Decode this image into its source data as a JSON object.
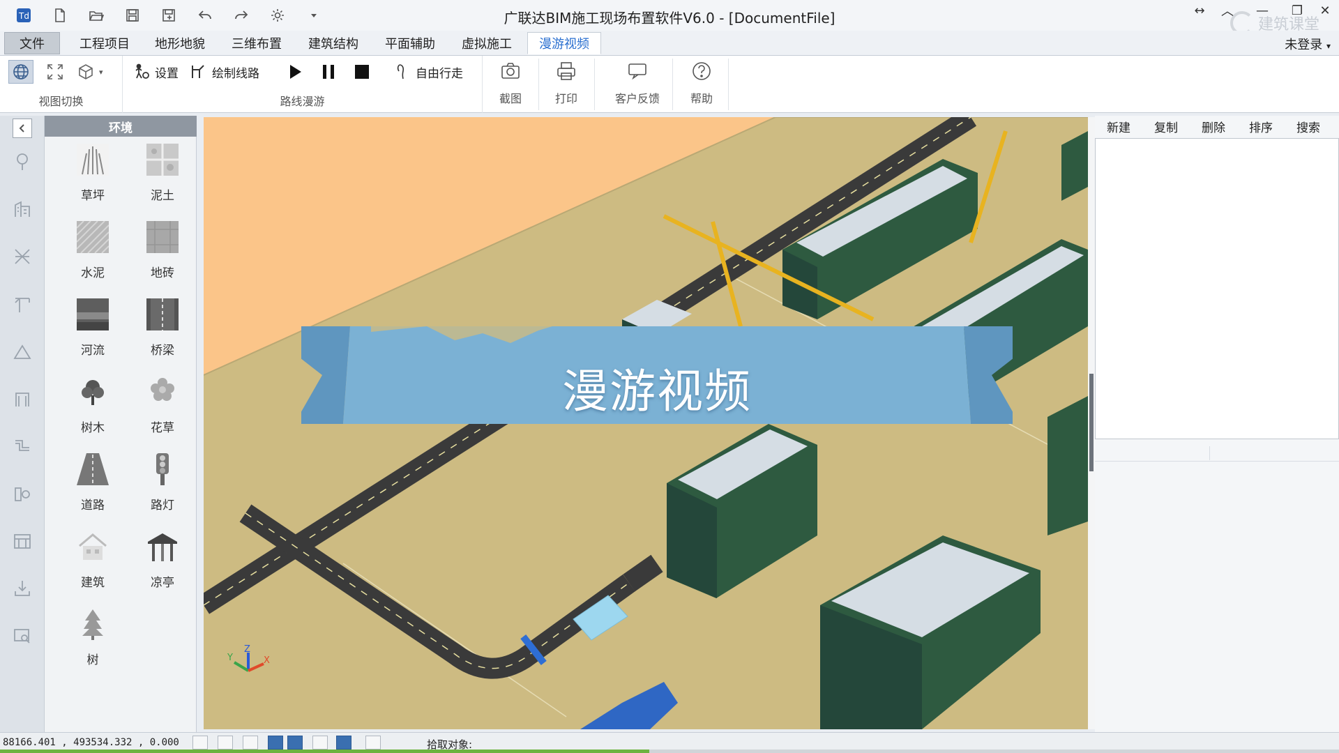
{
  "window": {
    "title": "广联达BIM施工现场布置软件V6.0 - [DocumentFile]",
    "user": "未登录",
    "brand_mark": "建筑课堂"
  },
  "quick_access": [
    "app-logo-icon",
    "new-file-icon",
    "open-folder-icon",
    "save-icon",
    "save-as-icon",
    "undo-icon",
    "redo-icon",
    "gear-icon",
    "dropdown-arrow-icon"
  ],
  "menu": {
    "tabs": [
      {
        "label": "文件",
        "id": "file"
      },
      {
        "label": "工程项目",
        "id": "project"
      },
      {
        "label": "地形地貌",
        "id": "terrain"
      },
      {
        "label": "三维布置",
        "id": "layout3d"
      },
      {
        "label": "建筑结构",
        "id": "structure"
      },
      {
        "label": "平面辅助",
        "id": "plane-aid"
      },
      {
        "label": "虚拟施工",
        "id": "virtual-build"
      },
      {
        "label": "漫游视频",
        "id": "walkthrough"
      }
    ],
    "active": "漫游视频"
  },
  "ribbon": {
    "view_switch": {
      "label": "视图切换"
    },
    "route_tour": {
      "label": "路线漫游",
      "settings": "设置",
      "draw_route": "绘制线路",
      "free_walk": "自由行走"
    },
    "screenshot": "截图",
    "print": "打印",
    "feedback": "客户反馈",
    "help": "帮助"
  },
  "palette": {
    "title": "环境",
    "items": [
      {
        "label": "草坪",
        "icon": "grass-icon"
      },
      {
        "label": "泥土",
        "icon": "soil-icon"
      },
      {
        "label": "水泥",
        "icon": "cement-icon"
      },
      {
        "label": "地砖",
        "icon": "floor-tile-icon"
      },
      {
        "label": "河流",
        "icon": "river-icon"
      },
      {
        "label": "桥梁",
        "icon": "bridge-icon"
      },
      {
        "label": "树木",
        "icon": "trees-icon"
      },
      {
        "label": "花草",
        "icon": "flower-icon"
      },
      {
        "label": "道路",
        "icon": "road-icon"
      },
      {
        "label": "路灯",
        "icon": "street-lamp-icon"
      },
      {
        "label": "建筑",
        "icon": "building-icon"
      },
      {
        "label": "凉亭",
        "icon": "pavilion-icon"
      },
      {
        "label": "树",
        "icon": "pine-tree-icon"
      }
    ]
  },
  "viewport": {
    "banner_title": "漫游视频",
    "axes": {
      "x": "X",
      "y": "Y",
      "z": "Z"
    }
  },
  "right_panel": {
    "toolbar": [
      "新建",
      "复制",
      "删除",
      "排序",
      "搜索"
    ]
  },
  "status": {
    "coords": "88166.401 , 493534.332 , 0.000",
    "pick_label": "拾取对象:",
    "progress": 0.485
  },
  "colors": {
    "accent": "#2a6fd0",
    "ground": "#cdbb82",
    "sky": "#fbc589",
    "road": "#3a3a3a",
    "building_wall": "#2e5a40",
    "crane": "#e8b320",
    "banner": "#7bb1d4"
  }
}
